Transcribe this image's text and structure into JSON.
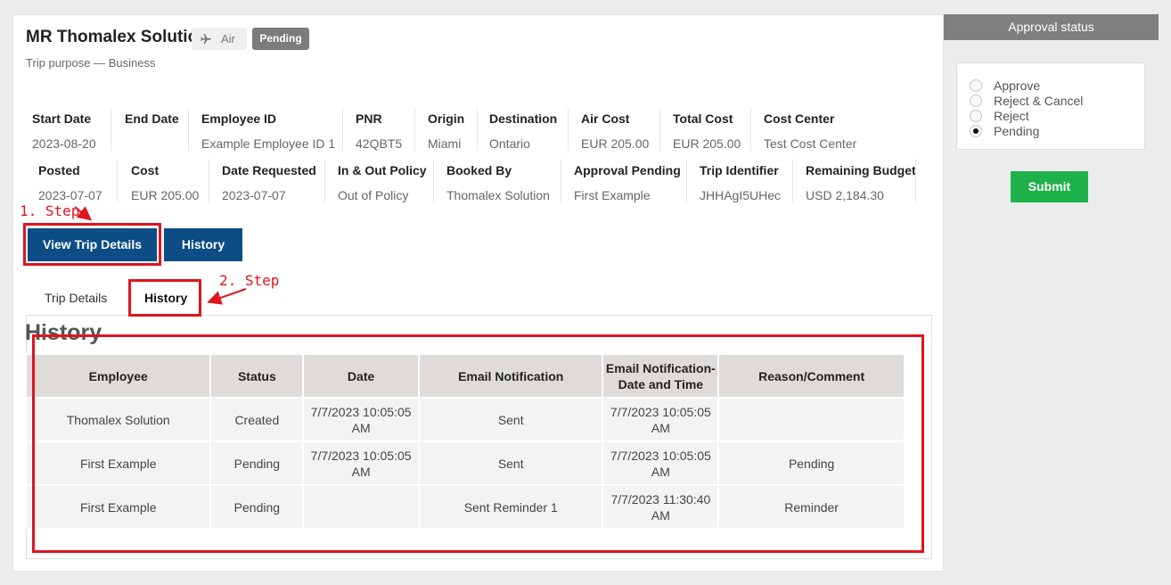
{
  "trip": {
    "title": "MR Thomalex Solution",
    "mode_badge": "Air",
    "status_badge": "Pending",
    "purpose": "Trip purpose — Business"
  },
  "fields_row1": [
    {
      "label": "Start Date",
      "value": "2023-08-20"
    },
    {
      "label": "End Date",
      "value": ""
    },
    {
      "label": "Employee ID",
      "value": "Example Employee ID 1"
    },
    {
      "label": "PNR",
      "value": "42QBT5"
    },
    {
      "label": "Origin",
      "value": "Miami"
    },
    {
      "label": "Destination",
      "value": "Ontario"
    },
    {
      "label": "Air Cost",
      "value": "EUR 205.00"
    },
    {
      "label": "Total Cost",
      "value": "EUR 205.00"
    },
    {
      "label": "Cost Center",
      "value": "Test Cost Center"
    }
  ],
  "fields_row2": [
    {
      "label": "Posted",
      "value": "2023-07-07"
    },
    {
      "label": "Cost",
      "value": "EUR 205.00"
    },
    {
      "label": "Date Requested",
      "value": "2023-07-07"
    },
    {
      "label": "In & Out Policy",
      "value": "Out of Policy"
    },
    {
      "label": "Booked By",
      "value": "Thomalex Solution"
    },
    {
      "label": "Approval Pending",
      "value": "First Example"
    },
    {
      "label": "Trip Identifier",
      "value": "JHHAgI5UHec"
    },
    {
      "label": "Remaining Budget",
      "value": "USD 2,184.30"
    }
  ],
  "buttons": {
    "view_trip_details": "View Trip Details",
    "history": "History"
  },
  "tabs": {
    "trip_details": "Trip Details",
    "history": "History"
  },
  "history": {
    "heading": "History",
    "columns": [
      "Employee",
      "Status",
      "Date",
      "Email Notification",
      "Email Notification-\nDate and Time",
      "Reason/Comment"
    ],
    "rows": [
      [
        "Thomalex Solution",
        "Created",
        "7/7/2023 10:05:05 AM",
        "Sent",
        "7/7/2023 10:05:05 AM",
        ""
      ],
      [
        "First Example",
        "Pending",
        "7/7/2023 10:05:05 AM",
        "Sent",
        "7/7/2023 10:05:05 AM",
        "Pending"
      ],
      [
        "First Example",
        "Pending",
        "",
        "Sent Reminder 1",
        "7/7/2023 11:30:40 AM",
        "Reminder"
      ]
    ]
  },
  "approval": {
    "header": "Approval status",
    "options": [
      {
        "label": "Approve",
        "checked": false
      },
      {
        "label": "Reject & Cancel",
        "checked": false
      },
      {
        "label": "Reject",
        "checked": false
      },
      {
        "label": "Pending",
        "checked": true
      }
    ],
    "submit_label": "Submit"
  },
  "annotations": {
    "step1": "1. Step",
    "step2": "2. Step",
    "color": "#e0141e"
  },
  "colors": {
    "primary_button": "#0c4d86",
    "submit_button": "#1fb24a",
    "status_badge": "#7b7b7b"
  }
}
